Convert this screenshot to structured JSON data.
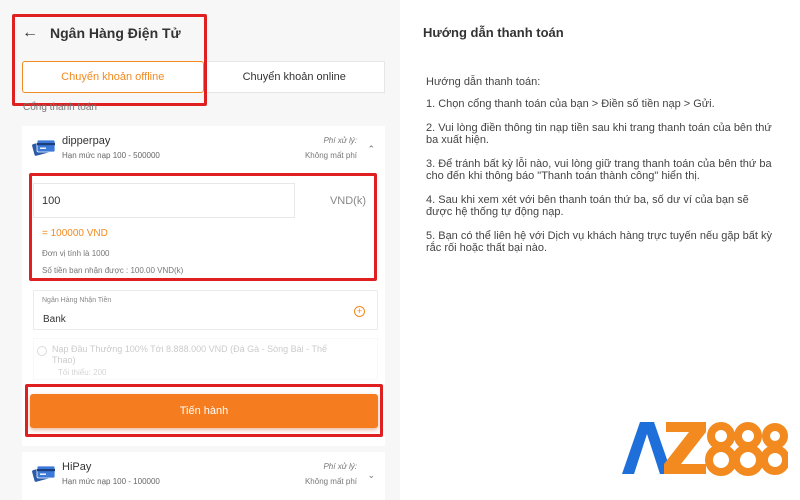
{
  "header": {
    "back_icon": "arrow-left-icon",
    "title": "Ngân Hàng Điện Tử"
  },
  "tabs": [
    {
      "label": "Chuyển khoản offline",
      "active": true
    },
    {
      "label": "Chuyển khoản online",
      "active": false
    }
  ],
  "section_label": "Cổng thanh toán",
  "gateways": [
    {
      "name": "dipperpay",
      "limit": "Hạn mức nạp 100 - 500000",
      "fee_label": "Phí xử lý:",
      "fee_value": "Không mất phí",
      "expanded": true
    },
    {
      "name": "HiPay",
      "limit": "Hạn mức nạp 100 - 100000",
      "fee_label": "Phí xử lý:",
      "fee_value": "Không mất phí",
      "expanded": false
    }
  ],
  "deposit": {
    "amount": "100",
    "unit": "VND(k)",
    "converted": "= 100000 VND",
    "unit_note": "Đơn vị tính là 1000",
    "received_note": "Số tiền bạn nhận được : 100.00 VND(k)"
  },
  "bank": {
    "label": "Ngân Hàng Nhận Tiền",
    "value": "Bank"
  },
  "promo": {
    "text": "Nạp Đầu Thưởng 100% Tới 8.888.000 VND (Đá Gà - Sòng Bài - Thể Thao)",
    "min": "Tối thiểu: 200"
  },
  "submit_label": "Tiến hành",
  "guide": {
    "title": "Hướng dẫn thanh toán",
    "intro": "Hướng dẫn thanh toán:",
    "steps": [
      "1. Chọn cổng thanh toán của bạn > Điền số tiền nạp > Gửi.",
      "2. Vui lòng điền thông tin nạp tiền sau khi trang thanh toán của bên thứ ba xuất hiện.",
      "3. Để tránh bất kỳ lỗi nào, vui lòng giữ trang thanh toán của bên thứ ba cho đến khi thông báo \"Thanh toán thành công\" hiển thị.",
      "4. Sau khi xem xét với bên thanh toán thứ ba, số dư ví của bạn sẽ được hệ thống tự động nạp.",
      "5. Bạn có thể liên hệ với Dịch vụ khách hàng trực tuyến nếu gặp bất kỳ rắc rối hoặc thất bại nào."
    ]
  },
  "logo": {
    "text": "AZ888",
    "colors": {
      "a": "#1e6fd9",
      "z": "#f28a1f",
      "digits": "#f28a1f"
    }
  },
  "colors": {
    "accent": "#f28a1f",
    "button": "#f57c1f",
    "highlight_box": "#e02020",
    "panel_bg": "#f7f7f7"
  }
}
